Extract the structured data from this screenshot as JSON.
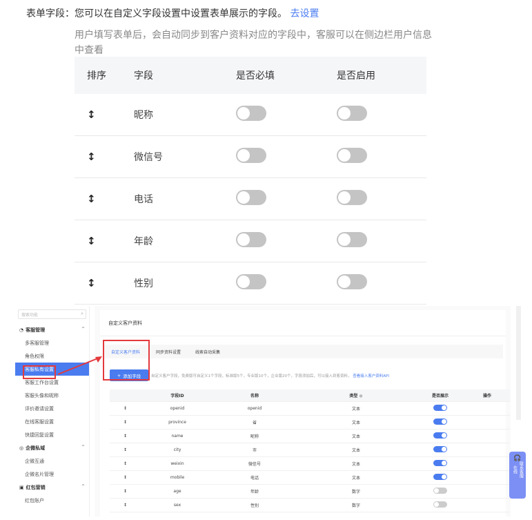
{
  "top": {
    "label": "表单字段：您可以在自定义字段设置中设置表单展示的字段。",
    "link": "去设置",
    "desc": "用户填写表单后，会自动同步到客户资料对应的字段中，客服可以在侧边栏用户信息中查看"
  },
  "big_table": {
    "headers": {
      "sort": "排序",
      "field": "字段",
      "required": "是否必填",
      "enabled": "是否启用"
    },
    "rows": [
      {
        "field": "昵称",
        "required": false,
        "enabled": false
      },
      {
        "field": "微信号",
        "required": false,
        "enabled": false
      },
      {
        "field": "电话",
        "required": false,
        "enabled": false
      },
      {
        "field": "年龄",
        "required": false,
        "enabled": false
      },
      {
        "field": "性别",
        "required": false,
        "enabled": false
      }
    ]
  },
  "sidebar": {
    "search_placeholder": "搜索功能",
    "groups": [
      {
        "title": "客服管理",
        "items": [
          "多客服管理",
          "角色权限",
          "客服私有设置",
          "客服工作台设置",
          "客服头像和昵称",
          "评价邀请设置",
          "在线客服设置",
          "快捷回复设置"
        ]
      },
      {
        "title": "企微私域",
        "items": [
          "企微互通",
          "企微名片管理"
        ]
      },
      {
        "title": "红包营销",
        "items": [
          "红包账户"
        ]
      }
    ],
    "active_item": "客服私有设置"
  },
  "main": {
    "title": "自定义客户资料",
    "tabs": [
      "自定义客户资料",
      "同步资料设置",
      "线索自动采集"
    ],
    "add_button": "添加字段",
    "note": "自定义客户字段，免费版可自定义1个字段，标准版5个，专业版10个，企业版20个，字段添加后，可以接入到客资料，",
    "note_link": "查看接入客户资料API",
    "table": {
      "headers": {
        "id": "字段ID",
        "name": "名称",
        "type": "类型",
        "show": "是否展示",
        "op": "操作"
      },
      "rows": [
        {
          "id": "openid",
          "name": "openid",
          "type": "文本",
          "show": true
        },
        {
          "id": "province",
          "name": "省",
          "type": "文本",
          "show": true
        },
        {
          "id": "name",
          "name": "昵称",
          "type": "文本",
          "show": true
        },
        {
          "id": "city",
          "name": "市",
          "type": "文本",
          "show": true
        },
        {
          "id": "weixin",
          "name": "微信号",
          "type": "文本",
          "show": true
        },
        {
          "id": "mobile",
          "name": "电话",
          "type": "文本",
          "show": true
        },
        {
          "id": "age",
          "name": "年龄",
          "type": "数字",
          "show": false
        },
        {
          "id": "sex",
          "name": "性别",
          "type": "数字",
          "show": false
        }
      ]
    }
  },
  "float_button": "联系客服",
  "float_side": "在线",
  "colors": {
    "accent": "#4a7cf0",
    "highlight": "#e4393c",
    "toggle_off": "#c4c4c4"
  }
}
